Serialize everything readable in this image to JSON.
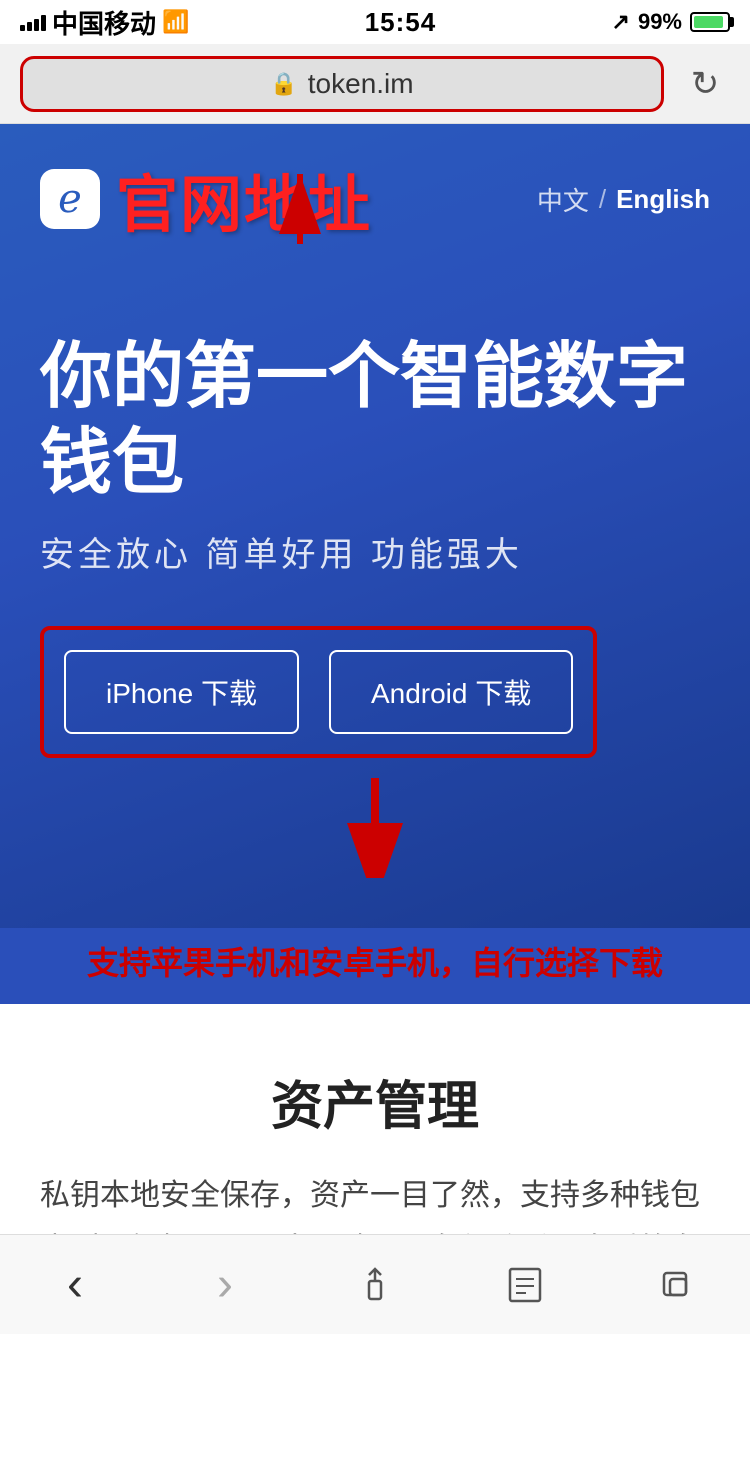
{
  "statusBar": {
    "carrier": "中国移动",
    "time": "15:54",
    "battery": "99%"
  },
  "browserBar": {
    "url": "token.im",
    "lockIcon": "🔒"
  },
  "header": {
    "siteTitle": "官网地址",
    "langZh": "中文",
    "langDivider": "/",
    "langEn": "English"
  },
  "hero": {
    "title": "你的第一个智能数字钱包",
    "subtitle": "安全放心  简单好用  功能强大"
  },
  "buttons": {
    "iphone": "iPhone 下载",
    "android": "Android 下载"
  },
  "annotation": {
    "text": "支持苹果手机和安卓手机，自行选择下载"
  },
  "assetSection": {
    "title": "资产管理",
    "desc": "私钥本地安全保存，资产一目了然，支持多种钱包类型，轻松导入导出，助记词备份防丢，多重签名防盗"
  },
  "bottomNav": {
    "back": "‹",
    "forward": "›",
    "share": "↑",
    "bookmarks": "📖",
    "tabs": "⧉"
  }
}
